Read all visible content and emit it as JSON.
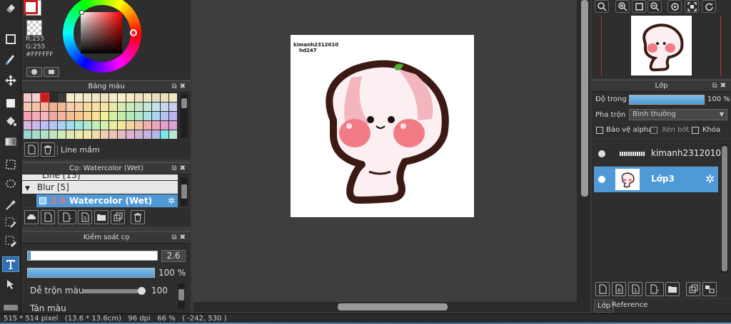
{
  "status": {
    "text": "515 * 514 pixel   (13.6 * 13.6cm)   96 dpi   66 %   ( -242, 530 )"
  },
  "color": {
    "r_label": "R:255",
    "g_label": "G:255",
    "hex": "#FFFFFF",
    "primary": "#c41f1f",
    "secondary": "#ffffff"
  },
  "palette_panel": {
    "title": "Bảng màu",
    "brush_name": "Line mầm"
  },
  "brush_panel": {
    "title": "Cọ: Watercolor (Wet)",
    "items": [
      {
        "label": "Line [13]"
      },
      {
        "label": "Blur [5]"
      },
      {
        "size": "2.6",
        "label": "Watercolor (Wet)"
      }
    ]
  },
  "control_panel": {
    "title": "Kiểm soát cọ",
    "size_value": "2.6",
    "size_fraction": 0.02,
    "opacity_value": "100 %",
    "opacity_fraction": 1.0,
    "blend_label": "Dễ trộn màu",
    "blend_value": "100",
    "blend_fraction": 1.0,
    "next_label": "Tán màu"
  },
  "canvas": {
    "text_line1": "kimanh2312010",
    "text_line2": "hd247"
  },
  "layer_panel": {
    "title": "Lớp",
    "opacity_label": "Độ trong",
    "opacity_value": "100 %",
    "opacity_fraction": 1.0,
    "blend_label": "Pha trộn",
    "blend_value": "Bình thường",
    "protect_alpha": "Bảo vệ alpha",
    "clipping": "Xén bớt",
    "lock": "Khóa",
    "layers": [
      {
        "name": "kimanh2312010",
        "selected": false
      },
      {
        "name": "Lớp3",
        "selected": true
      }
    ],
    "tabs": [
      "Lớp",
      "Reference"
    ]
  },
  "palette_colors": [
    [
      "#f2c6c6",
      "#f7cfcf",
      "#c41f1f",
      "#2b2b2b",
      "#3a3a3a",
      "#f7e8c6",
      "#f8ebc9",
      "#f6e7c4",
      "#f3e6c6",
      "#efe2c3",
      "#f7ecc9",
      "#f8efcb",
      "#f6ebc7",
      "#f0e2c0",
      "#f2e5c3",
      "#e9ddc0",
      "#efe0bd",
      "#f2e6c2"
    ],
    [
      "#f6c7b2",
      "#f5c1a9",
      "#f4b89e",
      "#f2b093",
      "#f3b898",
      "#f7cfb0",
      "#f7d3a5",
      "#f8da9f",
      "#f9e0a5",
      "#f4e5a7",
      "#e8eaa8",
      "#d5ebb1",
      "#c9eab9",
      "#c4e8c6",
      "#c4e7d6",
      "#c5e2e6",
      "#c7d7ef",
      "#cccbf2"
    ],
    [
      "#f0a0b0",
      "#f3abb7",
      "#f6b6bf",
      "#f0a7a4",
      "#f3b39c",
      "#f6bf93",
      "#f8c98f",
      "#f9d38f",
      "#f9e093",
      "#eef09b",
      "#d9f0a4",
      "#c2eea9",
      "#b4ebb8",
      "#ade8cc",
      "#abe2e0",
      "#acd4ee",
      "#b3c2f2",
      "#bdb4f2"
    ],
    [
      "#d8b4e2",
      "#cdb7ec",
      "#c0bdf2",
      "#b6c5f4",
      "#aad0f3",
      "#9fdcef",
      "#a2e6e2",
      "#b0ecd0",
      "#c4efbd",
      "#d6f0ab",
      "#e8ef9f",
      "#f4e79c",
      "#f7d69e",
      "#f5c3a5",
      "#f2b0ae",
      "#eea4bb",
      "#e79fcb",
      "#dca2d9"
    ],
    [
      "#9ad7d0",
      "#a6dccb",
      "#b5e1c5",
      "#c2e5bf",
      "#d1e8b8",
      "#dfe9b1",
      "#ecebad",
      "#f4e6ab",
      "#f6dcad",
      "#f3cfb1",
      "#eec3b8",
      "#e7b9c2",
      "#ddb3cd",
      "#d0b1d8",
      "#c2b3e0",
      "#b4b8e5",
      "#7ee6e8",
      "#b8ead2"
    ]
  ]
}
